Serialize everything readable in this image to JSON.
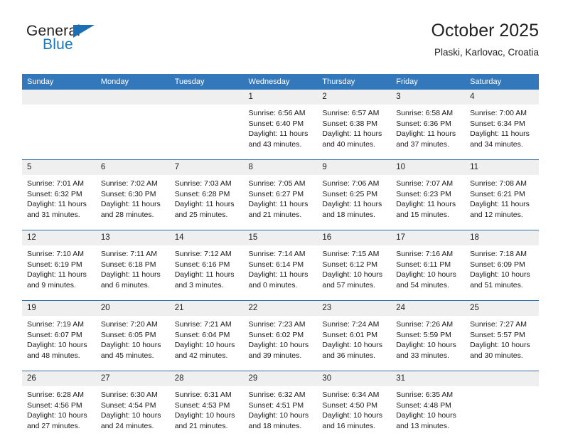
{
  "brand": {
    "name_top": "General",
    "name_bottom": "Blue",
    "triangle_color": "#1a6fb5",
    "blue_color": "#1878be"
  },
  "header": {
    "title": "October 2025",
    "location": "Plaski, Karlovac, Croatia"
  },
  "theme": {
    "header_blue": "#3478bc",
    "row_divider_blue": "#2f6eab",
    "daynum_band": "#efefef"
  },
  "calendar": {
    "weekday_headers": [
      "Sunday",
      "Monday",
      "Tuesday",
      "Wednesday",
      "Thursday",
      "Friday",
      "Saturday"
    ],
    "weeks": [
      [
        {
          "day": "",
          "lines": []
        },
        {
          "day": "",
          "lines": []
        },
        {
          "day": "",
          "lines": []
        },
        {
          "day": "1",
          "lines": [
            "Sunrise: 6:56 AM",
            "Sunset: 6:40 PM",
            "Daylight: 11 hours",
            "and 43 minutes."
          ]
        },
        {
          "day": "2",
          "lines": [
            "Sunrise: 6:57 AM",
            "Sunset: 6:38 PM",
            "Daylight: 11 hours",
            "and 40 minutes."
          ]
        },
        {
          "day": "3",
          "lines": [
            "Sunrise: 6:58 AM",
            "Sunset: 6:36 PM",
            "Daylight: 11 hours",
            "and 37 minutes."
          ]
        },
        {
          "day": "4",
          "lines": [
            "Sunrise: 7:00 AM",
            "Sunset: 6:34 PM",
            "Daylight: 11 hours",
            "and 34 minutes."
          ]
        }
      ],
      [
        {
          "day": "5",
          "lines": [
            "Sunrise: 7:01 AM",
            "Sunset: 6:32 PM",
            "Daylight: 11 hours",
            "and 31 minutes."
          ]
        },
        {
          "day": "6",
          "lines": [
            "Sunrise: 7:02 AM",
            "Sunset: 6:30 PM",
            "Daylight: 11 hours",
            "and 28 minutes."
          ]
        },
        {
          "day": "7",
          "lines": [
            "Sunrise: 7:03 AM",
            "Sunset: 6:28 PM",
            "Daylight: 11 hours",
            "and 25 minutes."
          ]
        },
        {
          "day": "8",
          "lines": [
            "Sunrise: 7:05 AM",
            "Sunset: 6:27 PM",
            "Daylight: 11 hours",
            "and 21 minutes."
          ]
        },
        {
          "day": "9",
          "lines": [
            "Sunrise: 7:06 AM",
            "Sunset: 6:25 PM",
            "Daylight: 11 hours",
            "and 18 minutes."
          ]
        },
        {
          "day": "10",
          "lines": [
            "Sunrise: 7:07 AM",
            "Sunset: 6:23 PM",
            "Daylight: 11 hours",
            "and 15 minutes."
          ]
        },
        {
          "day": "11",
          "lines": [
            "Sunrise: 7:08 AM",
            "Sunset: 6:21 PM",
            "Daylight: 11 hours",
            "and 12 minutes."
          ]
        }
      ],
      [
        {
          "day": "12",
          "lines": [
            "Sunrise: 7:10 AM",
            "Sunset: 6:19 PM",
            "Daylight: 11 hours",
            "and 9 minutes."
          ]
        },
        {
          "day": "13",
          "lines": [
            "Sunrise: 7:11 AM",
            "Sunset: 6:18 PM",
            "Daylight: 11 hours",
            "and 6 minutes."
          ]
        },
        {
          "day": "14",
          "lines": [
            "Sunrise: 7:12 AM",
            "Sunset: 6:16 PM",
            "Daylight: 11 hours",
            "and 3 minutes."
          ]
        },
        {
          "day": "15",
          "lines": [
            "Sunrise: 7:14 AM",
            "Sunset: 6:14 PM",
            "Daylight: 11 hours",
            "and 0 minutes."
          ]
        },
        {
          "day": "16",
          "lines": [
            "Sunrise: 7:15 AM",
            "Sunset: 6:12 PM",
            "Daylight: 10 hours",
            "and 57 minutes."
          ]
        },
        {
          "day": "17",
          "lines": [
            "Sunrise: 7:16 AM",
            "Sunset: 6:11 PM",
            "Daylight: 10 hours",
            "and 54 minutes."
          ]
        },
        {
          "day": "18",
          "lines": [
            "Sunrise: 7:18 AM",
            "Sunset: 6:09 PM",
            "Daylight: 10 hours",
            "and 51 minutes."
          ]
        }
      ],
      [
        {
          "day": "19",
          "lines": [
            "Sunrise: 7:19 AM",
            "Sunset: 6:07 PM",
            "Daylight: 10 hours",
            "and 48 minutes."
          ]
        },
        {
          "day": "20",
          "lines": [
            "Sunrise: 7:20 AM",
            "Sunset: 6:05 PM",
            "Daylight: 10 hours",
            "and 45 minutes."
          ]
        },
        {
          "day": "21",
          "lines": [
            "Sunrise: 7:21 AM",
            "Sunset: 6:04 PM",
            "Daylight: 10 hours",
            "and 42 minutes."
          ]
        },
        {
          "day": "22",
          "lines": [
            "Sunrise: 7:23 AM",
            "Sunset: 6:02 PM",
            "Daylight: 10 hours",
            "and 39 minutes."
          ]
        },
        {
          "day": "23",
          "lines": [
            "Sunrise: 7:24 AM",
            "Sunset: 6:01 PM",
            "Daylight: 10 hours",
            "and 36 minutes."
          ]
        },
        {
          "day": "24",
          "lines": [
            "Sunrise: 7:26 AM",
            "Sunset: 5:59 PM",
            "Daylight: 10 hours",
            "and 33 minutes."
          ]
        },
        {
          "day": "25",
          "lines": [
            "Sunrise: 7:27 AM",
            "Sunset: 5:57 PM",
            "Daylight: 10 hours",
            "and 30 minutes."
          ]
        }
      ],
      [
        {
          "day": "26",
          "lines": [
            "Sunrise: 6:28 AM",
            "Sunset: 4:56 PM",
            "Daylight: 10 hours",
            "and 27 minutes."
          ]
        },
        {
          "day": "27",
          "lines": [
            "Sunrise: 6:30 AM",
            "Sunset: 4:54 PM",
            "Daylight: 10 hours",
            "and 24 minutes."
          ]
        },
        {
          "day": "28",
          "lines": [
            "Sunrise: 6:31 AM",
            "Sunset: 4:53 PM",
            "Daylight: 10 hours",
            "and 21 minutes."
          ]
        },
        {
          "day": "29",
          "lines": [
            "Sunrise: 6:32 AM",
            "Sunset: 4:51 PM",
            "Daylight: 10 hours",
            "and 18 minutes."
          ]
        },
        {
          "day": "30",
          "lines": [
            "Sunrise: 6:34 AM",
            "Sunset: 4:50 PM",
            "Daylight: 10 hours",
            "and 16 minutes."
          ]
        },
        {
          "day": "31",
          "lines": [
            "Sunrise: 6:35 AM",
            "Sunset: 4:48 PM",
            "Daylight: 10 hours",
            "and 13 minutes."
          ]
        },
        {
          "day": "",
          "lines": []
        }
      ]
    ]
  }
}
